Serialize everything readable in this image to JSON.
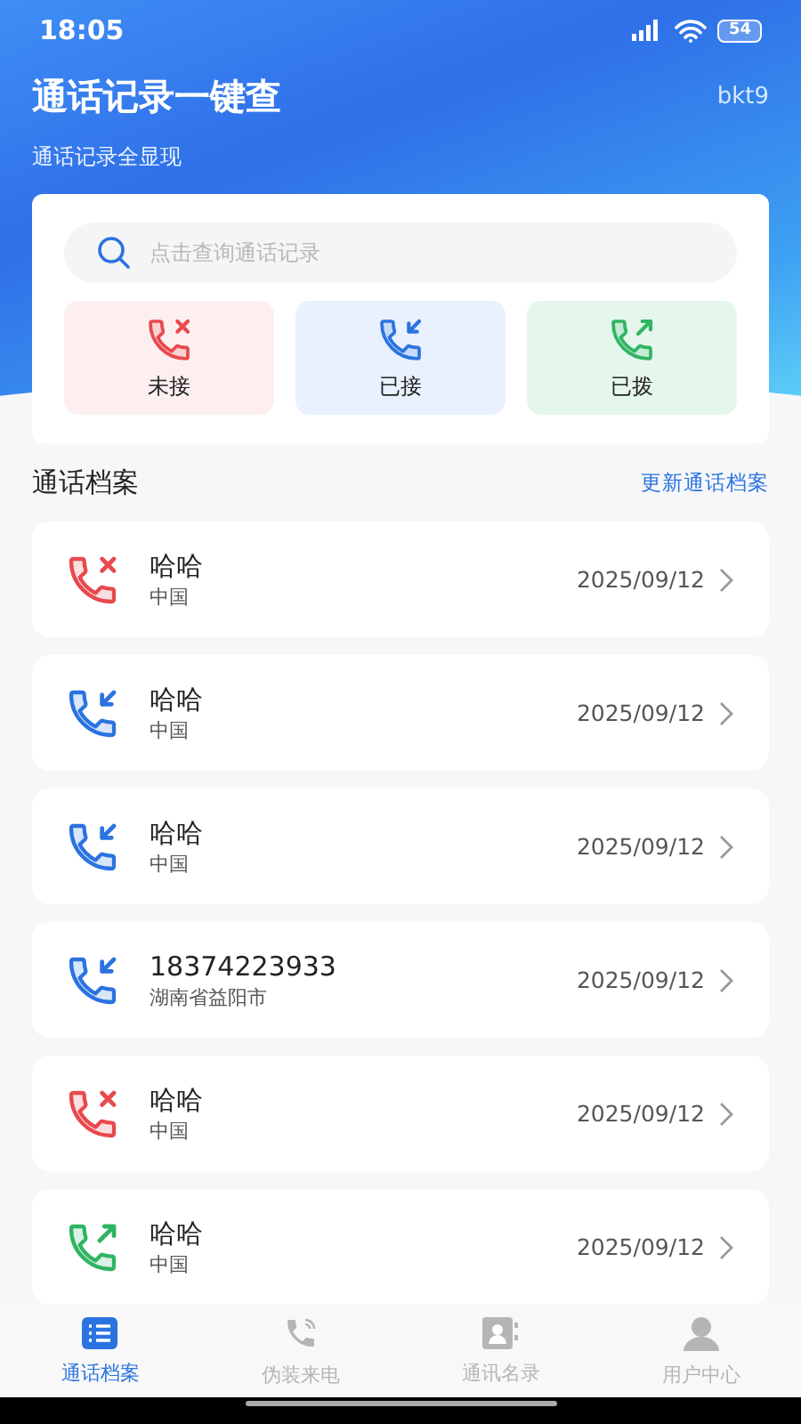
{
  "status_bar": {
    "time": "18:05",
    "battery": "54"
  },
  "header": {
    "title": "通话记录一键查",
    "subtitle": "通话记录全显现",
    "tag": "bkt9"
  },
  "search": {
    "placeholder": "点击查询通话记录"
  },
  "filters": [
    {
      "kind": "missed",
      "label": "未接"
    },
    {
      "kind": "received",
      "label": "已接"
    },
    {
      "kind": "dialed",
      "label": "已拨"
    }
  ],
  "section": {
    "title": "通话档案",
    "action": "更新通话档案"
  },
  "calls": [
    {
      "kind": "missed",
      "name": "哈哈",
      "location": "中国",
      "date": "2025/09/12"
    },
    {
      "kind": "received",
      "name": "哈哈",
      "location": "中国",
      "date": "2025/09/12"
    },
    {
      "kind": "received",
      "name": "哈哈",
      "location": "中国",
      "date": "2025/09/12"
    },
    {
      "kind": "received",
      "name": "18374223933",
      "location": "湖南省益阳市",
      "date": "2025/09/12"
    },
    {
      "kind": "missed",
      "name": "哈哈",
      "location": "中国",
      "date": "2025/09/12"
    },
    {
      "kind": "dialed",
      "name": "哈哈",
      "location": "中国",
      "date": "2025/09/12"
    }
  ],
  "bottom_nav": [
    {
      "kind": "list",
      "label": "通话档案",
      "selected": true
    },
    {
      "kind": "phone",
      "label": "伪装来电",
      "selected": false
    },
    {
      "kind": "card",
      "label": "通讯名录",
      "selected": false
    },
    {
      "kind": "user",
      "label": "用户中心",
      "selected": false
    }
  ]
}
